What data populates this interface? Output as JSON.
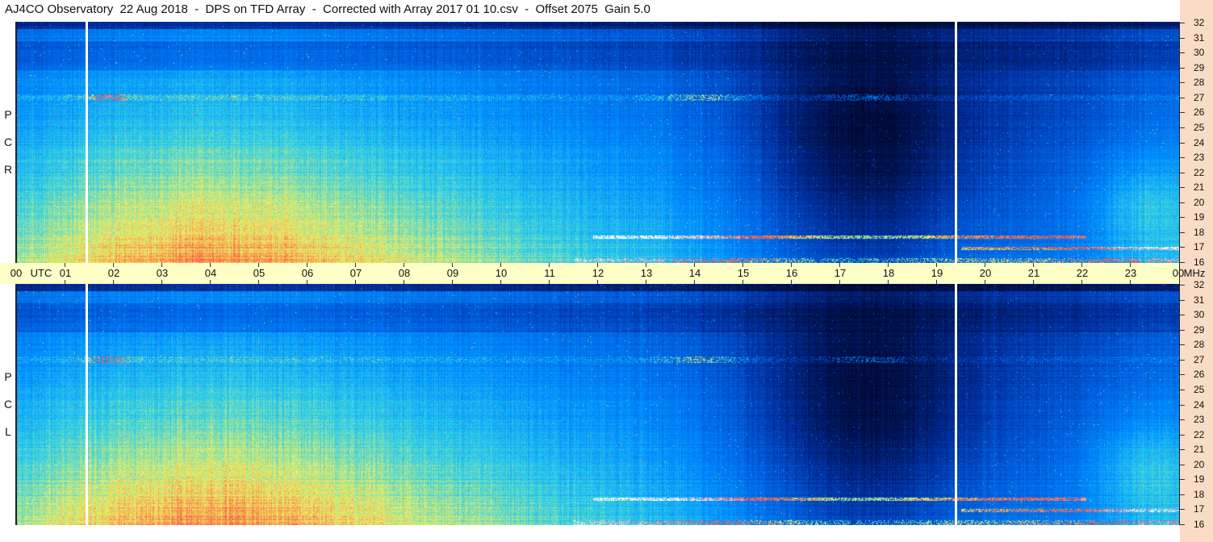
{
  "title": "AJ4CO Observatory  22 Aug 2018  -  DPS on TFD Array  -  Corrected with Array 2017 01 10.csv  -  Offset 2075  Gain 5.0",
  "time_axis": {
    "labels": [
      "00",
      "UTC",
      "01",
      "02",
      "03",
      "04",
      "05",
      "06",
      "07",
      "08",
      "09",
      "10",
      "11",
      "12",
      "13",
      "14",
      "15",
      "16",
      "17",
      "18",
      "19",
      "20",
      "21",
      "22",
      "23",
      "00",
      "MHz"
    ]
  },
  "panels": [
    {
      "name": "RCP",
      "letters": [
        "R",
        "C",
        "P"
      ]
    },
    {
      "name": "LCP",
      "letters": [
        "L",
        "C",
        "P"
      ]
    }
  ],
  "freq_ticks": [
    "32",
    "31",
    "30",
    "29",
    "28",
    "27",
    "26",
    "25",
    "24",
    "23",
    "22",
    "21",
    "20",
    "19",
    "18",
    "17",
    "16"
  ],
  "colors": {
    "axis_band": "#ffffc8",
    "right_strip": "#fadcc6",
    "marker": "#ffffff"
  },
  "chart_data": {
    "type": "heatmap",
    "title": "AJ4CO Observatory  22 Aug 2018  -  DPS on TFD Array  -  Corrected with Array 2017 01 10.csv  -  Offset 2075  Gain 5.0",
    "xlabel": "UTC",
    "ylabel": "MHz",
    "x_range_hours": [
      0,
      24
    ],
    "y_range_mhz": [
      16,
      32
    ],
    "panels": [
      "RCP",
      "LCP"
    ],
    "vertical_markers_utc_hours": [
      1.45,
      19.4
    ],
    "colormap": [
      "#000010",
      "#00104a",
      "#0030a0",
      "#0060e0",
      "#0090ff",
      "#30d0e8",
      "#f0f060",
      "#ff4040",
      "#ffffff"
    ]
  }
}
